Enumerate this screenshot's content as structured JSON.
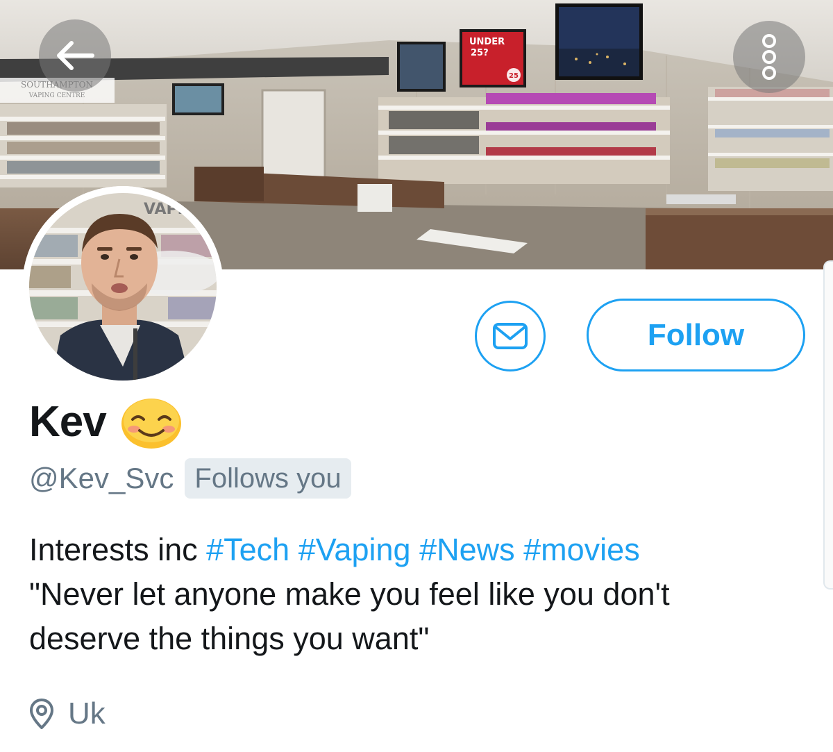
{
  "header": {
    "back_icon": "arrow-left-icon",
    "more_icon": "more-options-icon",
    "banner_sign_text": "SOUTHAMPTON VAPING CENTRE",
    "banner_screen_text": "UNDER 25?",
    "banner_screen_number": "25"
  },
  "profile": {
    "display_name": "Kev",
    "name_emoji": "smiling-face-emoji",
    "handle": "@Kev_Svc",
    "follows_you_badge": "Follows you",
    "bio": {
      "prefix": "Interests inc",
      "hashtags": [
        "#Tech",
        "#Vaping",
        "#News",
        "#movies"
      ],
      "quote_line1": "\"Never let anyone make you feel like you don't",
      "quote_line2": "deserve the things you want\""
    },
    "location": "Uk",
    "location_icon": "location-pin-icon"
  },
  "actions": {
    "message_icon": "envelope-icon",
    "follow_label": "Follow"
  },
  "colors": {
    "accent": "#1da1f2",
    "secondary_text": "#657786",
    "primary_text": "#14171a",
    "badge_bg": "#e6ecf0"
  }
}
